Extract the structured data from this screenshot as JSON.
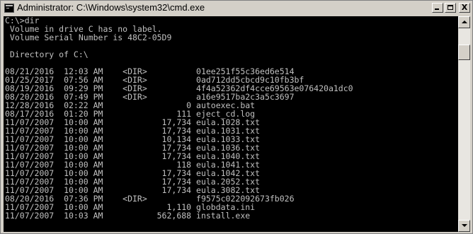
{
  "window": {
    "title": "Administrator: C:\\Windows\\system32\\cmd.exe",
    "app_icon": "console-icon",
    "controls": {
      "minimize": "minimize-icon",
      "maximize": "maximize-icon",
      "close_glyph": "X"
    }
  },
  "console": {
    "text_color": "#c0c0c0",
    "background": "#000000",
    "lines": [
      "C:\\>dir",
      " Volume in drive C has no label.",
      " Volume Serial Number is 48C2-05D9",
      "",
      " Directory of C:\\",
      "",
      "08/21/2016  12:03 AM    <DIR>          01ee251f55c36ed6e514",
      "01/25/2017  07:56 AM    <DIR>          0ad712dd5cbcd9c10fb3bf",
      "08/19/2016  09:29 PM    <DIR>          4f4a52362df4cce69563e076420a1dc0",
      "08/20/2016  07:49 PM    <DIR>          a16e9517ba2c3a5c3697",
      "12/28/2016  02:22 AM                 0 autoexec.bat",
      "08/17/2016  01:20 PM               111 eject_cd.log",
      "11/07/2007  10:00 AM            17,734 eula.1028.txt",
      "11/07/2007  10:00 AM            17,734 eula.1031.txt",
      "11/07/2007  10:00 AM            10,134 eula.1033.txt",
      "11/07/2007  10:00 AM            17,734 eula.1036.txt",
      "11/07/2007  10:00 AM            17,734 eula.1040.txt",
      "11/07/2007  10:00 AM               118 eula.1041.txt",
      "11/07/2007  10:00 AM            17,734 eula.1042.txt",
      "11/07/2007  10:00 AM            17,734 eula.2052.txt",
      "11/07/2007  10:00 AM            17,734 eula.3082.txt",
      "08/20/2016  07:36 PM    <DIR>          f9575c022092673fb026",
      "11/07/2007  10:00 AM             1,110 globdata.ini",
      "11/07/2007  10:03 AM           562,688 install.exe"
    ]
  }
}
